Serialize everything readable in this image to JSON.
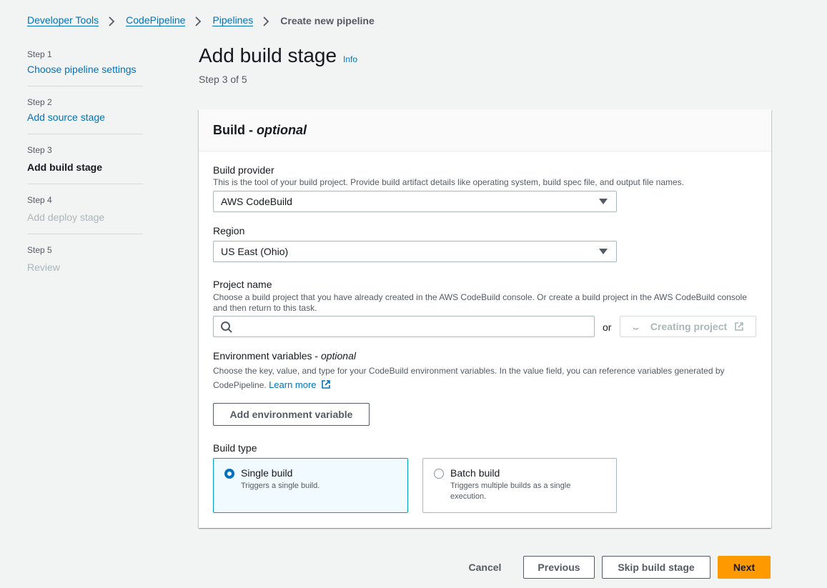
{
  "breadcrumb": {
    "items": [
      "Developer Tools",
      "CodePipeline",
      "Pipelines"
    ],
    "current": "Create new pipeline"
  },
  "steps": [
    {
      "num": "Step 1",
      "label": "Choose pipeline settings"
    },
    {
      "num": "Step 2",
      "label": "Add source stage"
    },
    {
      "num": "Step 3",
      "label": "Add build stage"
    },
    {
      "num": "Step 4",
      "label": "Add deploy stage"
    },
    {
      "num": "Step 5",
      "label": "Review"
    }
  ],
  "page": {
    "title": "Add build stage",
    "info": "Info",
    "step_of": "Step 3 of 5"
  },
  "panel": {
    "title": "Build - ",
    "title_optional": "optional",
    "build_provider": {
      "label": "Build provider",
      "desc": "This is the tool of your build project. Provide build artifact details like operating system, build spec file, and output file names.",
      "value": "AWS CodeBuild"
    },
    "region": {
      "label": "Region",
      "value": "US East (Ohio)"
    },
    "project_name": {
      "label": "Project name",
      "desc": "Choose a build project that you have already created in the AWS CodeBuild console. Or create a build project in the AWS CodeBuild console and then return to this task.",
      "value": "",
      "or": "or",
      "create_button": "Creating project"
    },
    "env_vars": {
      "label": "Environment variables - ",
      "label_optional": "optional",
      "desc": "Choose the key, value, and type for your CodeBuild environment variables. In the value field, you can reference variables generated by CodePipeline.",
      "learn_more": "Learn more",
      "add_button": "Add environment variable"
    },
    "build_type": {
      "label": "Build type",
      "options": [
        {
          "title": "Single build",
          "desc": "Triggers a single build.",
          "selected": true
        },
        {
          "title": "Batch build",
          "desc": "Triggers multiple builds as a single execution.",
          "selected": false
        }
      ]
    }
  },
  "footer": {
    "cancel": "Cancel",
    "previous": "Previous",
    "skip": "Skip build stage",
    "next": "Next"
  },
  "colors": {
    "link": "#0073bb",
    "primary": "#ff9900",
    "selected_border": "#00a1c9"
  }
}
